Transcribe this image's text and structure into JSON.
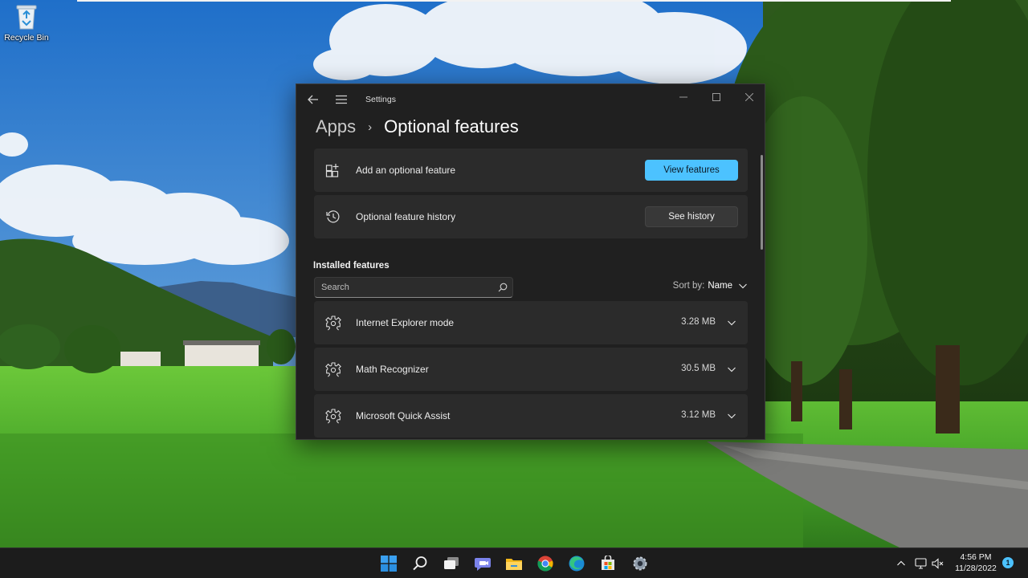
{
  "desktop": {
    "recycle_bin_label": "Recycle Bin"
  },
  "window": {
    "title": "Settings",
    "breadcrumb_parent": "Apps",
    "breadcrumb_separator": "›",
    "page_title": "Optional features"
  },
  "add_card": {
    "icon": "add-grid-icon",
    "label": "Add an optional feature",
    "button": "View features"
  },
  "history_card": {
    "icon": "history-icon",
    "label": "Optional feature history",
    "button": "See history"
  },
  "installed": {
    "title": "Installed features",
    "search_placeholder": "Search",
    "sort_label": "Sort by:",
    "sort_value": "Name",
    "items": [
      {
        "name": "Internet Explorer mode",
        "size": "3.28 MB",
        "icon": "puzzle-gear-icon"
      },
      {
        "name": "Math Recognizer",
        "size": "30.5 MB",
        "icon": "puzzle-gear-icon"
      },
      {
        "name": "Microsoft Quick Assist",
        "size": "3.12 MB",
        "icon": "puzzle-gear-icon"
      }
    ]
  },
  "taskbar": {
    "apps": [
      "start-icon",
      "search-icon",
      "task-view-icon",
      "teams-chat-icon",
      "file-explorer-icon",
      "chrome-icon",
      "edge-icon",
      "store-icon",
      "settings-icon"
    ],
    "time": "4:56 PM",
    "date": "11/28/2022",
    "notification_count": "1"
  },
  "colors": {
    "accent": "#4cc2ff",
    "window_bg": "#202020",
    "card_bg": "#2b2b2b",
    "taskbar_bg": "#1c1c1c"
  }
}
